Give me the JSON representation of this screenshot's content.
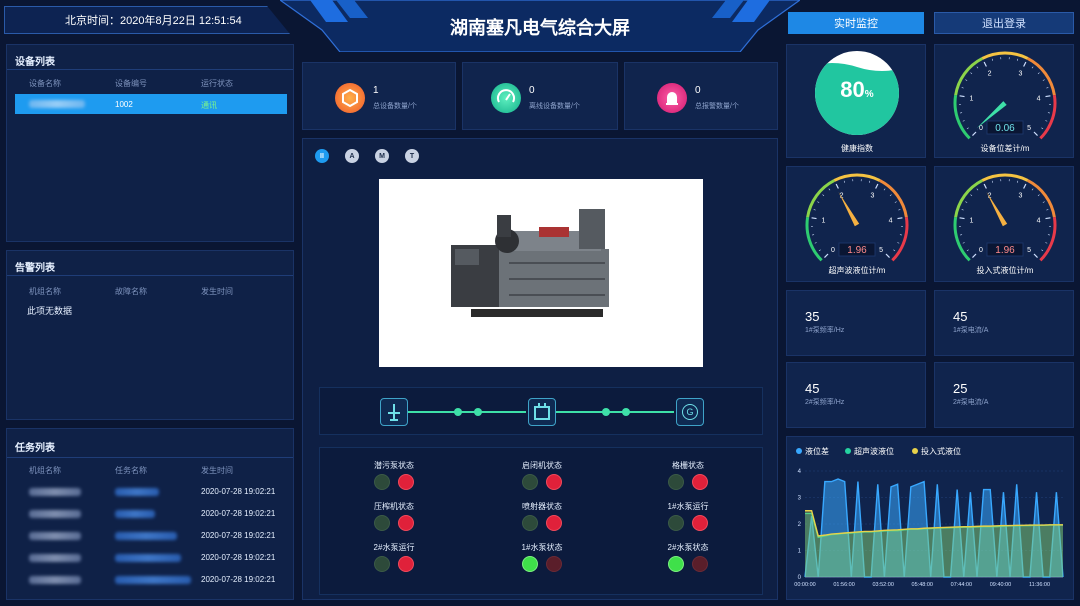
{
  "header": {
    "clock_label": "北京时间：",
    "clock": "2020年8月22日 12:51:54",
    "title": "湖南塞凡电气综合大屏",
    "btn_monitor": "实时监控",
    "btn_logout": "退出登录"
  },
  "device_list": {
    "title": "设备列表",
    "cols": [
      "设备名称",
      "设备编号",
      "运行状态"
    ],
    "row": {
      "code": "1002",
      "status": "通讯"
    }
  },
  "alarm_list": {
    "title": "告警列表",
    "cols": [
      "机组名称",
      "故障名称",
      "发生时间"
    ],
    "empty": "此项无数据"
  },
  "task_list": {
    "title": "任务列表",
    "cols": [
      "机组名称",
      "任务名称",
      "发生时间"
    ],
    "rows": [
      {
        "time": "2020-07-28 19:02:21"
      },
      {
        "time": "2020-07-28 19:02:21"
      },
      {
        "time": "2020-07-28 19:02:21"
      },
      {
        "time": "2020-07-28 19:02:21"
      },
      {
        "time": "2020-07-28 19:02:21"
      }
    ]
  },
  "stats": [
    {
      "value": "1",
      "label": "总设备数量/个",
      "color": "#f07a2a"
    },
    {
      "value": "0",
      "label": "离线设备数量/个",
      "color": "#1fc6a8"
    },
    {
      "value": "0",
      "label": "总报警数量/个",
      "color": "#e0207c"
    }
  ],
  "modes": [
    "II",
    "A",
    "M",
    "T"
  ],
  "flow_icons": [
    "pump-tower-icon",
    "motor-icon",
    "generator-icon"
  ],
  "flow_g": "G",
  "status_items": [
    {
      "label": "潜污泵状态",
      "on": false
    },
    {
      "label": "启闭机状态",
      "on": false
    },
    {
      "label": "格栅状态",
      "on": false
    },
    {
      "label": "压榨机状态",
      "on": false
    },
    {
      "label": "喷射器状态",
      "on": false
    },
    {
      "label": "1#水泵运行",
      "on": false
    },
    {
      "label": "2#水泵运行",
      "on": false
    },
    {
      "label": "1#水泵状态",
      "on": true
    },
    {
      "label": "2#水泵状态",
      "on": true
    }
  ],
  "health": {
    "value": "80",
    "unit": "%",
    "label": "健康指数"
  },
  "gauges": [
    {
      "label": "设备位差计/m",
      "value": 0.06,
      "display": "0.06",
      "ticks": [
        "0",
        "1",
        "2",
        "3",
        "4",
        "5"
      ]
    },
    {
      "label": "超声波液位计/m",
      "value": 1.96,
      "display": "1.96",
      "ticks": [
        "0",
        "1",
        "2",
        "3",
        "4",
        "5"
      ]
    },
    {
      "label": "投入式液位计/m",
      "value": 1.96,
      "display": "1.96",
      "ticks": [
        "0",
        "1",
        "2",
        "3",
        "4",
        "5"
      ]
    }
  ],
  "metrics": [
    {
      "value": "35",
      "label": "1#泵频率/Hz"
    },
    {
      "value": "45",
      "label": "1#泵电流/A"
    },
    {
      "value": "45",
      "label": "2#泵频率/Hz"
    },
    {
      "value": "25",
      "label": "2#泵电流/A"
    }
  ],
  "chart_data": {
    "type": "line",
    "legend": [
      {
        "name": "液位差",
        "color": "#38a8ff"
      },
      {
        "name": "超声波液位",
        "color": "#25d3a0"
      },
      {
        "name": "投入式液位",
        "color": "#e8d24a"
      }
    ],
    "x_labels": [
      "00:00:00",
      "01:56:00",
      "03:52:00",
      "05:48:00",
      "07:44:00",
      "09:40:00",
      "11:36:00"
    ],
    "y_ticks": [
      "0",
      "1",
      "2",
      "3",
      "4"
    ],
    "ylim": [
      0,
      4
    ],
    "series": [
      {
        "name": "液位差",
        "values": [
          0,
          2.3,
          0,
          3.6,
          3.6,
          3.7,
          3.6,
          0,
          3.6,
          0,
          0,
          3.5,
          0,
          3.4,
          3.5,
          0,
          3.4,
          3.5,
          3.6,
          0,
          3.5,
          0,
          0,
          3.3,
          0,
          3.2,
          0,
          3.3,
          3.3,
          0,
          3.2,
          0,
          3.5,
          0,
          0,
          3.2,
          0,
          0,
          3.2,
          0
        ]
      },
      {
        "name": "超声波液位",
        "values": [
          2.4,
          2.4,
          1.5,
          1.55,
          1.6,
          1.62,
          1.65,
          1.66,
          1.68,
          1.7,
          1.7,
          1.72,
          1.74,
          1.75,
          1.75,
          1.78,
          1.8,
          1.8,
          1.82,
          1.83,
          1.85,
          1.85,
          1.86,
          1.87,
          1.88,
          1.88,
          1.89,
          1.9,
          1.9,
          1.9,
          1.92,
          1.93,
          1.93,
          1.94,
          1.94,
          1.95,
          1.95,
          1.96,
          1.96,
          1.96
        ]
      },
      {
        "name": "投入式液位",
        "values": [
          2.5,
          2.5,
          1.55,
          1.58,
          1.62,
          1.64,
          1.66,
          1.68,
          1.7,
          1.72,
          1.72,
          1.74,
          1.76,
          1.77,
          1.78,
          1.8,
          1.82,
          1.82,
          1.84,
          1.85,
          1.86,
          1.87,
          1.88,
          1.89,
          1.9,
          1.9,
          1.91,
          1.92,
          1.92,
          1.93,
          1.94,
          1.94,
          1.95,
          1.95,
          1.96,
          1.96,
          1.96,
          1.97,
          1.97,
          1.97
        ]
      }
    ]
  }
}
